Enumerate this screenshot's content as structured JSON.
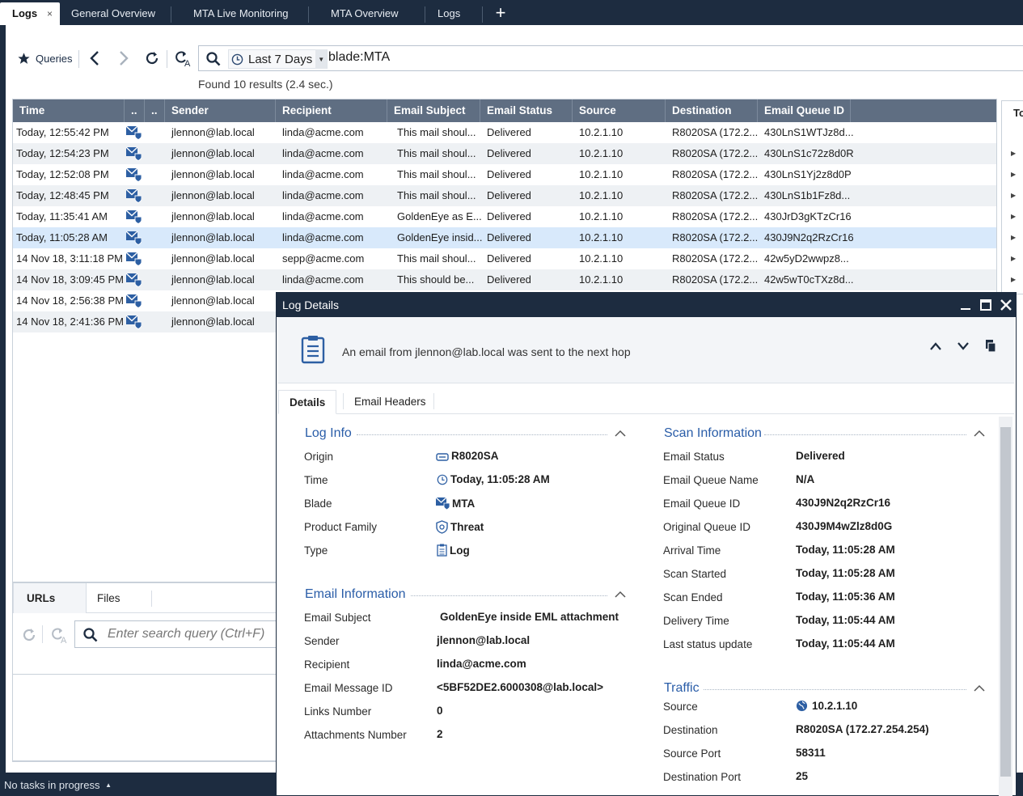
{
  "tabs": [
    {
      "label": "Logs",
      "active": true
    },
    {
      "label": "General Overview"
    },
    {
      "label": "MTA Live Monitoring"
    },
    {
      "label": "MTA Overview"
    },
    {
      "label": "Logs"
    }
  ],
  "tab_close_glyph": "×",
  "add_tab_glyph": "+",
  "toolbar": {
    "queries_label": "Queries",
    "time_range": "Last 7 Days",
    "query": "blade:MTA",
    "results": "Found 10 results (2.4 sec.)"
  },
  "table": {
    "headers": [
      "Time",
      "..",
      "..",
      "Sender",
      "Recipient",
      "Email Subject",
      "Email Status",
      "Source",
      "Destination",
      "Email Queue ID"
    ],
    "rows": [
      {
        "time": "Today, 12:55:42 PM",
        "sender": "jlennon@lab.local",
        "recipient": "linda@acme.com",
        "subject": "This mail shoul...",
        "status": "Delivered",
        "source": "10.2.1.10",
        "destination": "R8020SA (172.2...",
        "queue_id": "430LnS1WTJz8d..."
      },
      {
        "time": "Today, 12:54:23 PM",
        "sender": "jlennon@lab.local",
        "recipient": "linda@acme.com",
        "subject": "This mail shoul...",
        "status": "Delivered",
        "source": "10.2.1.10",
        "destination": "R8020SA (172.2...",
        "queue_id": "430LnS1c72z8d0R"
      },
      {
        "time": "Today, 12:52:08 PM",
        "sender": "jlennon@lab.local",
        "recipient": "linda@acme.com",
        "subject": "This mail shoul...",
        "status": "Delivered",
        "source": "10.2.1.10",
        "destination": "R8020SA (172.2...",
        "queue_id": "430LnS1Yj2z8d0P"
      },
      {
        "time": "Today, 12:48:45 PM",
        "sender": "jlennon@lab.local",
        "recipient": "linda@acme.com",
        "subject": "This mail shoul...",
        "status": "Delivered",
        "source": "10.2.1.10",
        "destination": "R8020SA (172.2...",
        "queue_id": "430LnS1b1Fz8d..."
      },
      {
        "time": "Today, 11:35:41 AM",
        "sender": "jlennon@lab.local",
        "recipient": "linda@acme.com",
        "subject": "GoldenEye as E...",
        "status": "Delivered",
        "source": "10.2.1.10",
        "destination": "R8020SA (172.2...",
        "queue_id": "430JrD3gKTzCr16"
      },
      {
        "time": "Today, 11:05:28 AM",
        "sender": "jlennon@lab.local",
        "recipient": "linda@acme.com",
        "subject": "GoldenEye insid...",
        "status": "Delivered",
        "source": "10.2.1.10",
        "destination": "R8020SA (172.2...",
        "queue_id": "430J9N2q2RzCr16",
        "selected": true
      },
      {
        "time": "14 Nov 18, 3:11:18 PM",
        "sender": "jlennon@lab.local",
        "recipient": "sepp@acme.com",
        "subject": "This mail shoul...",
        "status": "Delivered",
        "source": "10.2.1.10",
        "destination": "R8020SA (172.2...",
        "queue_id": "42w5yD2wwpz8..."
      },
      {
        "time": "14 Nov 18, 3:09:45 PM",
        "sender": "jlennon@lab.local",
        "recipient": "linda@acme.com",
        "subject": "This should be...",
        "status": "Delivered",
        "source": "10.2.1.10",
        "destination": "R8020SA (172.2...",
        "queue_id": "42w5wT0cTXz8d..."
      },
      {
        "time": "14 Nov 18, 2:56:38 PM",
        "sender": "jlennon@lab.local"
      },
      {
        "time": "14 Nov 18, 2:41:36 PM",
        "sender": "jlennon@lab.local"
      }
    ]
  },
  "right_panel_title": "To",
  "bottom": {
    "tabs": [
      "URLs",
      "Files"
    ],
    "search_placeholder": "Enter search query (Ctrl+F)"
  },
  "status_bar": "No tasks in progress",
  "dialog": {
    "title": "Log Details",
    "header_message": "An email from jlennon@lab.local was sent to the next hop",
    "tabs": [
      "Details",
      "Email Headers"
    ],
    "log_info": {
      "title": "Log Info",
      "origin_label": "Origin",
      "origin": "R8020SA",
      "time_label": "Time",
      "time": "Today, 11:05:28 AM",
      "blade_label": "Blade",
      "blade": "MTA",
      "family_label": "Product Family",
      "family": "Threat",
      "type_label": "Type",
      "type": "Log"
    },
    "email_info": {
      "title": "Email Information",
      "subject_label": "Email Subject",
      "subject": "GoldenEye inside EML attachment",
      "sender_label": "Sender",
      "sender": "jlennon@lab.local",
      "recipient_label": "Recipient",
      "recipient": "linda@acme.com",
      "message_id_label": "Email Message ID",
      "message_id": "<5BF52DE2.6000308@lab.local>",
      "links_label": "Links Number",
      "links": "0",
      "attachments_label": "Attachments Number",
      "attachments": "2"
    },
    "scan_info": {
      "title": "Scan Information",
      "status_label": "Email Status",
      "status": "Delivered",
      "queue_name_label": "Email Queue Name",
      "queue_name": "N/A",
      "queue_id_label": "Email Queue ID",
      "queue_id": "430J9N2q2RzCr16",
      "orig_queue_label": "Original Queue ID",
      "orig_queue": "430J9M4wZlz8d0G",
      "arrival_label": "Arrival Time",
      "arrival": "Today, 11:05:28 AM",
      "scan_started_label": "Scan Started",
      "scan_started": "Today, 11:05:28 AM",
      "scan_ended_label": "Scan Ended",
      "scan_ended": "Today, 11:05:36 AM",
      "delivery_label": "Delivery Time",
      "delivery": "Today, 11:05:44 AM",
      "last_update_label": "Last status update",
      "last_update": "Today, 11:05:44 AM"
    },
    "traffic": {
      "title": "Traffic",
      "source_label": "Source",
      "source": "10.2.1.10",
      "dest_label": "Destination",
      "dest": "R8020SA (172.27.254.254)",
      "sport_label": "Source Port",
      "sport": "58311",
      "dport_label": "Destination Port",
      "dport": "25"
    }
  },
  "colors": {
    "frame": "#1d2c40",
    "header_row": "#5f6e82",
    "selected_row": "#d8e9fb",
    "section_title": "#2a5da8",
    "blade_icon": "#2d5fa3"
  }
}
